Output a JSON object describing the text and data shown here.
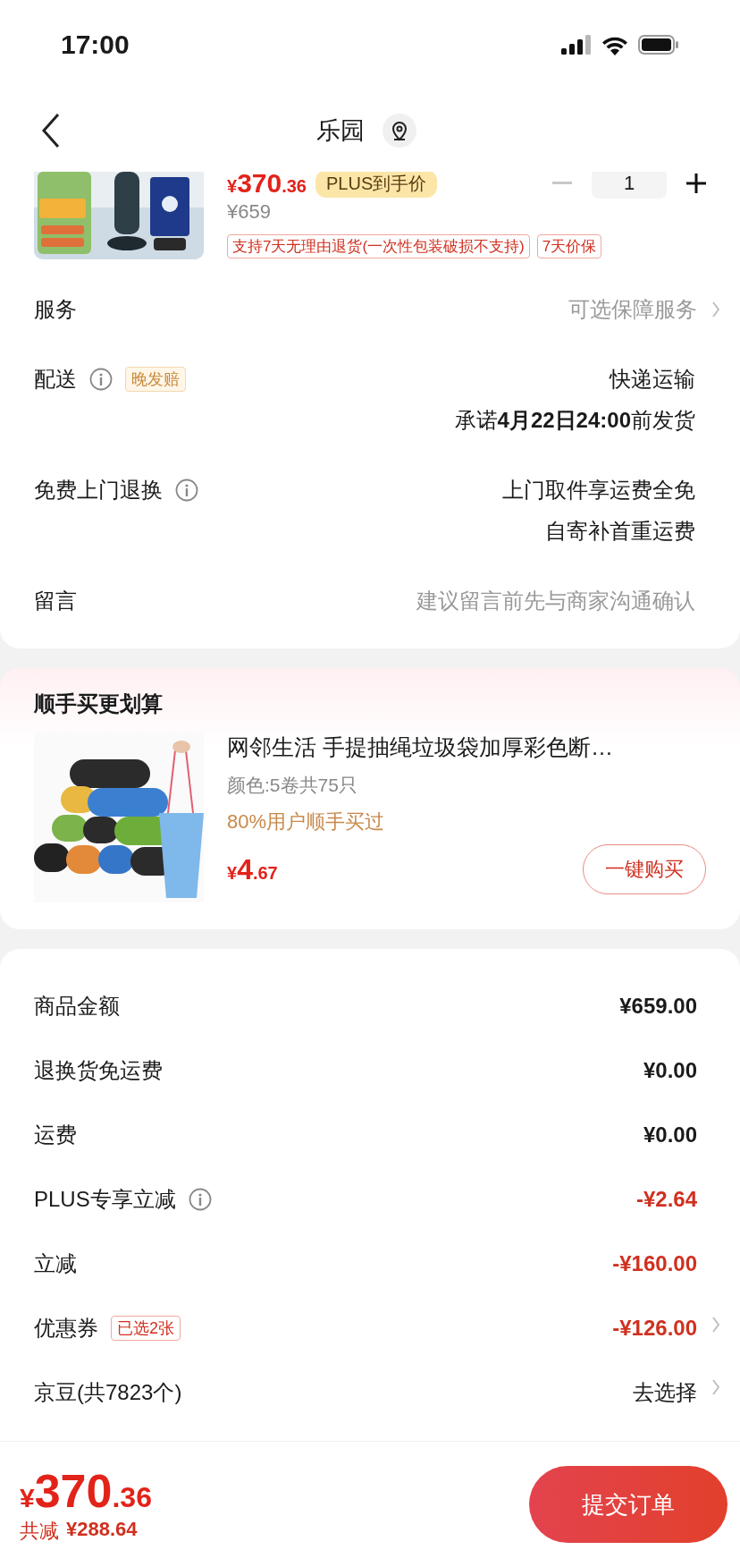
{
  "status_bar": {
    "time": "17:00"
  },
  "header": {
    "title": "乐园"
  },
  "product": {
    "price_yen": "¥",
    "price_int": "370",
    "price_dec": ".36",
    "price_badge": "PLUS到手价",
    "original_price": "¥659",
    "quantity": "1",
    "tags": [
      "支持7天无理由退货(一次性包装破损不支持)",
      "7天价保"
    ]
  },
  "order_rows": [
    {
      "label": "服务",
      "info_icon": false,
      "badge": null,
      "values": [
        "可选保障服务"
      ],
      "kind": "muted",
      "chevron": true
    },
    {
      "label": "配送",
      "info_icon": true,
      "badge": "晚发赔",
      "values": [
        "快递运输",
        "承诺**4月22日24:00**前发货"
      ],
      "kind": "normal",
      "chevron": false
    },
    {
      "label": "免费上门退换",
      "info_icon": true,
      "badge": null,
      "values": [
        "上门取件享运费全免",
        "自寄补首重运费"
      ],
      "kind": "normal",
      "chevron": false
    },
    {
      "label": "留言",
      "info_icon": false,
      "badge": null,
      "values": [
        "建议留言前先与商家沟通确认"
      ],
      "kind": "muted",
      "chevron": false
    }
  ],
  "suggestion": {
    "title": "顺手买更划算",
    "name": "网邻生活 手提抽绳垃圾袋加厚彩色断…",
    "spec": "颜色:5卷共75只",
    "social_proof": "80%用户顺手买过",
    "price_yen": "¥",
    "price_int": "4",
    "price_dec": ".67",
    "button": "一键购买"
  },
  "summary_rows": [
    {
      "label": "商品金额",
      "info_icon": false,
      "badge": null,
      "value": "¥659.00",
      "kind": "normal",
      "chevron": false
    },
    {
      "label": "退换货免运费",
      "info_icon": false,
      "badge": null,
      "value": "¥0.00",
      "kind": "normal",
      "chevron": false
    },
    {
      "label": "运费",
      "info_icon": false,
      "badge": null,
      "value": "¥0.00",
      "kind": "normal",
      "chevron": false
    },
    {
      "label": "PLUS专享立减",
      "info_icon": true,
      "badge": null,
      "value": "-¥2.64",
      "kind": "discount",
      "chevron": false
    },
    {
      "label": "立减",
      "info_icon": false,
      "badge": null,
      "value": "-¥160.00",
      "kind": "discount",
      "chevron": false
    },
    {
      "label": "优惠券",
      "info_icon": false,
      "badge": "已选2张",
      "value": "-¥126.00",
      "kind": "discount",
      "chevron": true
    },
    {
      "label": "京豆(共7823个)",
      "info_icon": false,
      "badge": null,
      "value": "去选择",
      "kind": "plain",
      "chevron": true
    }
  ],
  "footer": {
    "price_yen": "¥",
    "price_int": "370",
    "price_dec": ".36",
    "saved_label": "共减",
    "saved_value": "¥288.64",
    "button": "提交订单"
  }
}
